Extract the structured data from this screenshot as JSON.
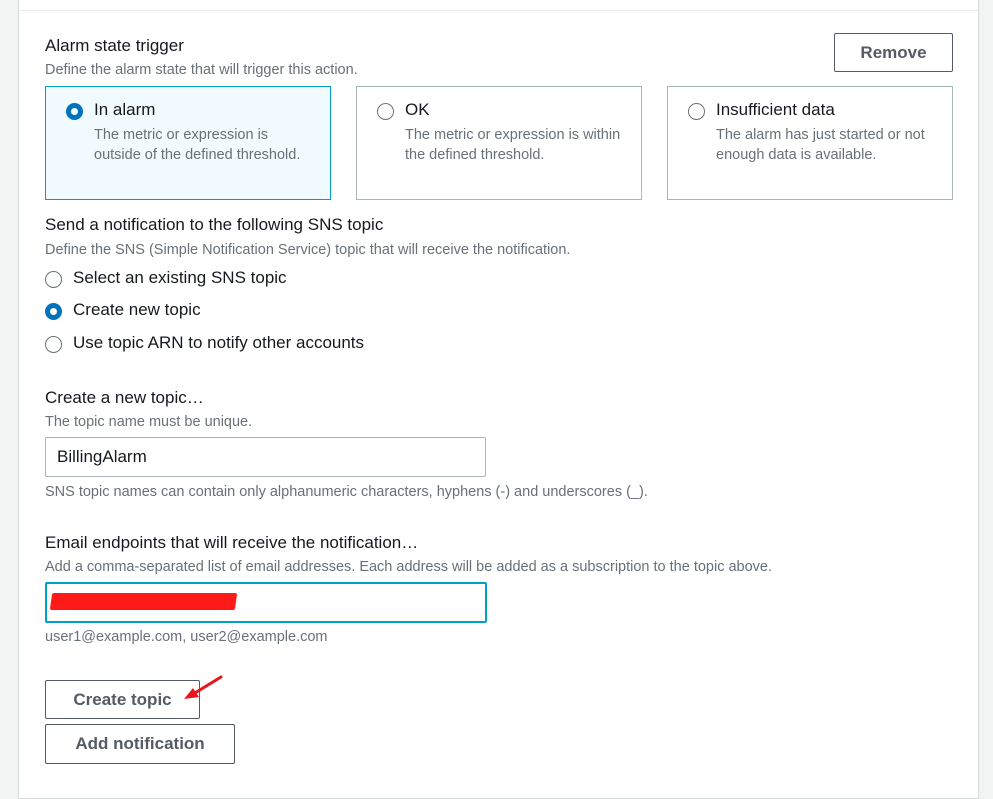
{
  "trigger": {
    "label": "Alarm state trigger",
    "description": "Define the alarm state that will trigger this action.",
    "remove_label": "Remove",
    "options": [
      {
        "title": "In alarm",
        "description": "The metric or expression is outside of the defined threshold.",
        "selected": true
      },
      {
        "title": "OK",
        "description": "The metric or expression is within the defined threshold.",
        "selected": false
      },
      {
        "title": "Insufficient data",
        "description": "The alarm has just started or not enough data is available.",
        "selected": false
      }
    ]
  },
  "sns": {
    "label": "Send a notification to the following SNS topic",
    "description": "Define the SNS (Simple Notification Service) topic that will receive the notification.",
    "options": [
      {
        "label": "Select an existing SNS topic",
        "selected": false
      },
      {
        "label": "Create new topic",
        "selected": true
      },
      {
        "label": "Use topic ARN to notify other accounts",
        "selected": false
      }
    ]
  },
  "new_topic": {
    "label": "Create a new topic…",
    "description": "The topic name must be unique.",
    "value": "BillingAlarm",
    "constraint": "SNS topic names can contain only alphanumeric characters, hyphens (-) and underscores (_)."
  },
  "email": {
    "label": "Email endpoints that will receive the notification…",
    "description": "Add a comma-separated list of email addresses. Each address will be added as a subscription to the topic above.",
    "value": "",
    "hint": "user1@example.com, user2@example.com"
  },
  "actions": {
    "create_topic_label": "Create topic",
    "add_notification_label": "Add notification"
  },
  "colors": {
    "accent": "#0073bb",
    "focus": "#00a1c9",
    "annotation": "#e8161b"
  }
}
